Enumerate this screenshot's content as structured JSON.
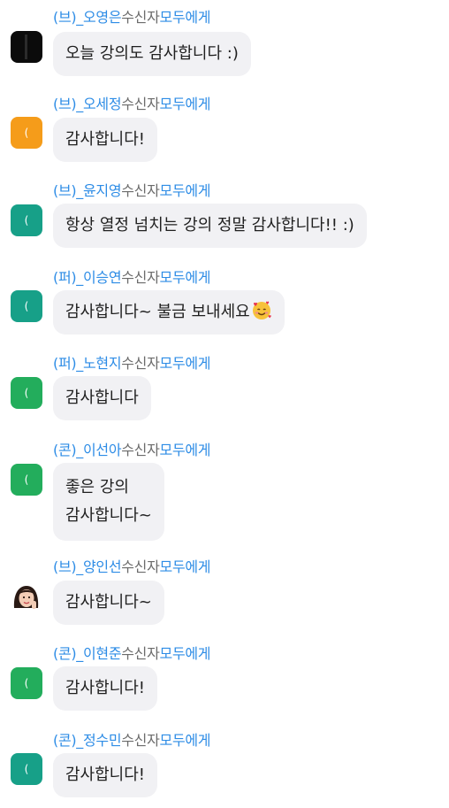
{
  "separator": "수신자",
  "recipient": "모두에게",
  "messages": [
    {
      "sender": "(브)_오영은",
      "lines": [
        "오늘 강의도 감사합니다 :)"
      ],
      "avatar": "black",
      "initial": ""
    },
    {
      "sender": "(브)_오세정",
      "lines": [
        "감사합니다!"
      ],
      "avatar": "orange",
      "initial": "("
    },
    {
      "sender": "(브)_윤지영",
      "lines": [
        "항상 열정 넘치는 강의 정말 감사합니다!! :)"
      ],
      "avatar": "teal",
      "initial": "("
    },
    {
      "sender": "(퍼)_이승연",
      "lines": [
        "감사합니다~ 불금 보내세요"
      ],
      "avatar": "teal",
      "initial": "(",
      "emoji": "smiling-face-with-hearts"
    },
    {
      "sender": "(퍼)_노현지",
      "lines": [
        "감사합니다"
      ],
      "avatar": "green",
      "initial": "("
    },
    {
      "sender": "(콘)_이선아",
      "lines": [
        "좋은 강의",
        "감사합니다~"
      ],
      "avatar": "green",
      "initial": "("
    },
    {
      "sender": "(브)_양인선",
      "lines": [
        "감사합니다~"
      ],
      "avatar": "photo",
      "initial": ""
    },
    {
      "sender": "(콘)_이현준",
      "lines": [
        "감사합니다!"
      ],
      "avatar": "green",
      "initial": "("
    },
    {
      "sender": "(콘)_정수민",
      "lines": [
        "감사합니다!"
      ],
      "avatar": "teal",
      "initial": "("
    }
  ]
}
